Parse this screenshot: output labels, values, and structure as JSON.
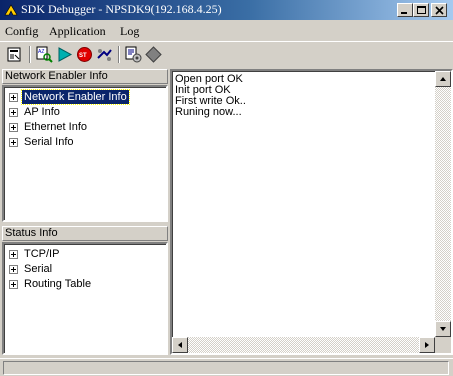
{
  "window": {
    "title": "SDK Debugger - NPSDK9(192.168.4.25)",
    "icon": "app-arrow-icon"
  },
  "menu": [
    {
      "label": "Config"
    },
    {
      "label": "Application"
    },
    {
      "label": "Log"
    }
  ],
  "toolbar": {
    "icons": [
      "properties-icon",
      "search-icon",
      "run-icon",
      "stop-icon",
      "connect-icon",
      "settings-icon",
      "break-icon"
    ]
  },
  "network_panel": {
    "header": "Network Enabler Info",
    "items": [
      {
        "label": "Network Enabler Info",
        "selected": true
      },
      {
        "label": "AP Info"
      },
      {
        "label": "Ethernet Info"
      },
      {
        "label": "Serial Info"
      }
    ]
  },
  "status_panel": {
    "header": "Status Info",
    "items": [
      {
        "label": "TCP/IP"
      },
      {
        "label": "Serial"
      },
      {
        "label": "Routing Table"
      }
    ]
  },
  "log": {
    "lines": [
      "Open port  OK",
      "Init port OK",
      "First write Ok..",
      "Runing now..."
    ]
  },
  "statusbar": {
    "text": ""
  },
  "colors": {
    "title_start": "#0a246a",
    "title_end": "#a6caf0",
    "face": "#d4d0c8",
    "selection": "#0a246a"
  }
}
